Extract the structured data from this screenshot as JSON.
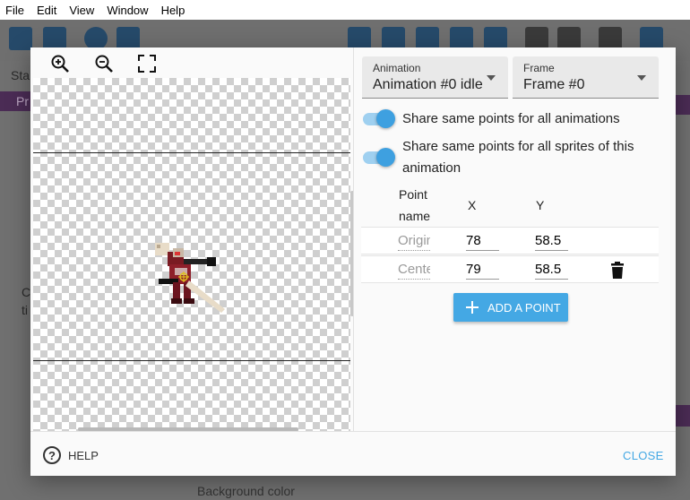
{
  "menubar": {
    "items": [
      "File",
      "Edit",
      "View",
      "Window",
      "Help"
    ]
  },
  "background": {
    "status_text": "Sta",
    "side_tab_text": "Pr",
    "left_text_1": "C",
    "left_text_2": "ti",
    "bottom_text": "Background color"
  },
  "dialog": {
    "animation_select": {
      "label": "Animation",
      "value": "Animation #0 idle"
    },
    "frame_select": {
      "label": "Frame",
      "value": "Frame #0"
    },
    "toggles": [
      {
        "text": "Share same points for all animations",
        "on": true
      },
      {
        "text": "Share same points for all sprites of this animation",
        "on": true
      }
    ],
    "table": {
      "headers": {
        "name": "Point name",
        "x": "X",
        "y": "Y"
      },
      "rows": [
        {
          "name": "Origin",
          "x": "78",
          "y": "58.5",
          "deletable": false
        },
        {
          "name": "Center",
          "x": "79",
          "y": "58.5",
          "deletable": true
        }
      ]
    },
    "add_point_label": "ADD A POINT",
    "footer": {
      "help_label": "HELP",
      "help_icon_glyph": "?",
      "close_label": "CLOSE"
    }
  },
  "colors": {
    "accent": "#44a8e4",
    "toggle_on": "#3ea0e0",
    "toolbar_icon": "#264a6a"
  }
}
